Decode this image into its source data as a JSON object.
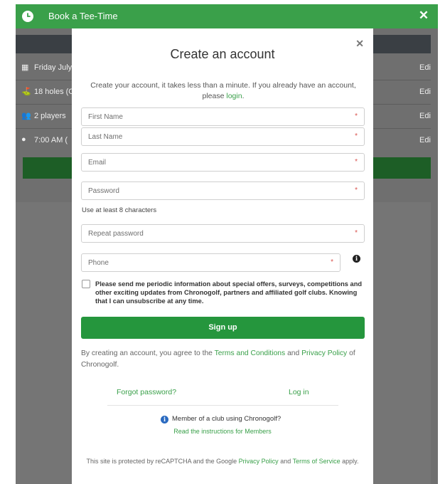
{
  "topbar": {
    "title": "Book a Tee-Time"
  },
  "background": {
    "rows": [
      {
        "icon": "calendar-icon",
        "glyph": "▦",
        "text": "Friday July",
        "edit": "Edi"
      },
      {
        "icon": "golfer-icon",
        "glyph": "⛳",
        "text": "18 holes (C",
        "edit": "Edi"
      },
      {
        "icon": "players-icon",
        "glyph": "👥",
        "text": "2 players",
        "edit": "Edi"
      },
      {
        "icon": "clock-icon",
        "glyph": "●",
        "text": "7:00 AM (",
        "edit": "Edi"
      }
    ]
  },
  "modal": {
    "title": "Create an account",
    "intro_text": "Create your account, it takes less than a minute. If you already have an account, please",
    "intro_link": "login",
    "intro_end": ".",
    "fields": {
      "first_name": "First Name",
      "last_name": "Last Name",
      "email": "Email",
      "password": "Password",
      "repeat_password": "Repeat password",
      "phone": "Phone"
    },
    "required_marker": "*",
    "password_hint": "Use at least 8 characters",
    "consent_text": "Please send me periodic information about special offers, surveys, competitions and other exciting updates from Chronogolf, partners and affiliated golf clubs. Knowing that I can unsubscribe at any time.",
    "signup_label": "Sign up",
    "terms": {
      "prefix": "By creating an account, you agree to the",
      "terms_link": "Terms and Conditions",
      "and": "and",
      "privacy_link": "Privacy Policy",
      "suffix": "of Chronogolf."
    },
    "forgot_password": "Forgot password?",
    "log_in": "Log in",
    "member_text": "Member of a club using Chronogolf?",
    "member_link": "Read the instructions for Members",
    "recaptcha": {
      "prefix": "This site is protected by reCAPTCHA and the Google",
      "privacy_link": "Privacy Policy",
      "and": "and",
      "terms_link": "Terms of Service",
      "suffix": "apply."
    }
  },
  "colors": {
    "brand_green": "#3aa04a",
    "button_green": "#25963d",
    "required_red": "#d9534f"
  }
}
